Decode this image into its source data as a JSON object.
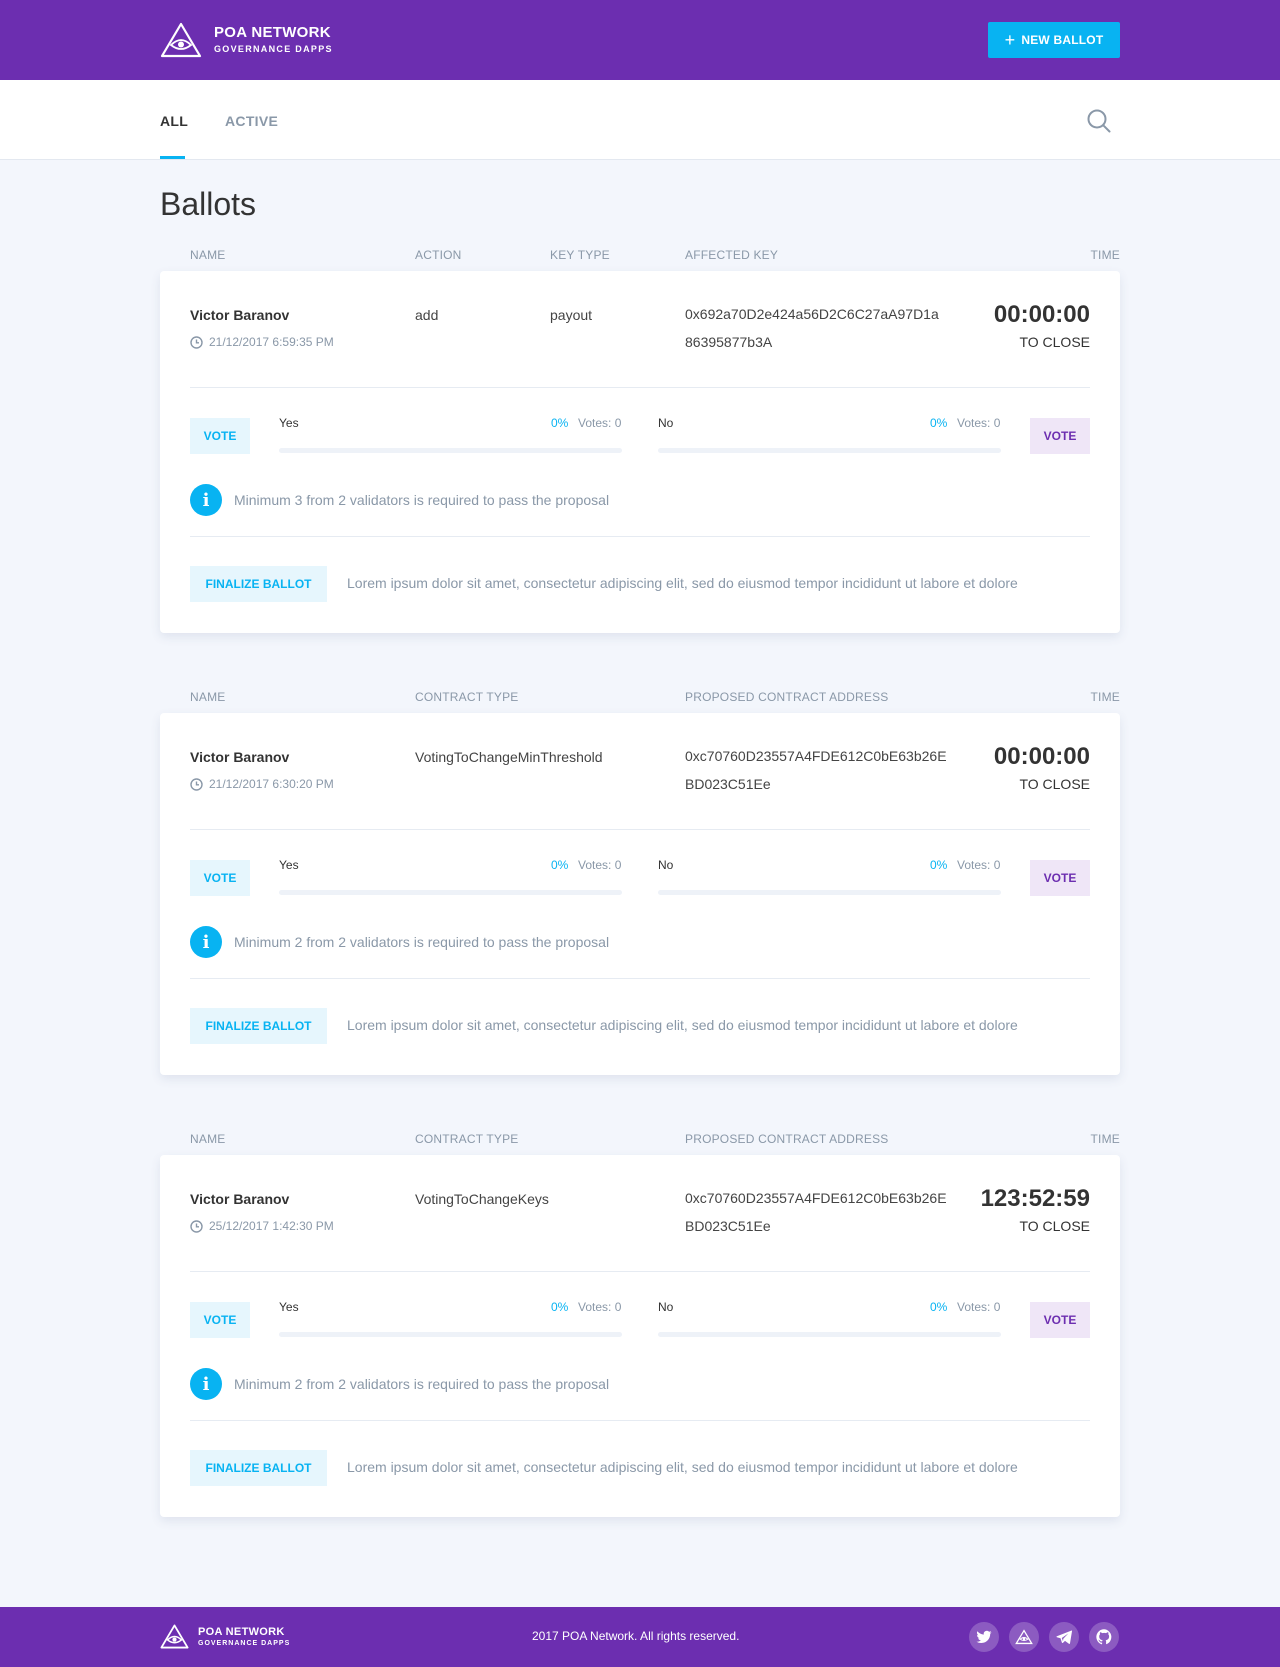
{
  "header": {
    "logo_title": "POA NETWORK",
    "logo_subtitle": "GOVERNANCE DAPPS",
    "new_ballot_label": "NEW BALLOT",
    "new_ballot_icon": "plus-icon"
  },
  "nav": {
    "tabs": [
      {
        "label": "ALL",
        "active": true
      },
      {
        "label": "ACTIVE",
        "active": false
      }
    ],
    "search_icon": "search-icon"
  },
  "page_title": "Ballots",
  "colors": {
    "brand_purple": "#6c2eb0",
    "accent_blue": "#08b3f2",
    "background": "#f3f6fc",
    "muted_text": "#8a98a8"
  },
  "ballots": [
    {
      "columns": {
        "name": "NAME",
        "col2": "ACTION",
        "col3": "KEY TYPE",
        "col4": "AFFECTED KEY",
        "time": "TIME"
      },
      "name": "Victor Baranov",
      "date": "21/12/2017 6:59:35 PM",
      "col2_value": "add",
      "col3_value": "payout",
      "address_line1": "0x692a70D2e424a56D2C6C27aA97D1a",
      "address_line2": "86395877b3A",
      "time": "00:00:00",
      "time_caption": "TO CLOSE",
      "vote_yes_label": "VOTE",
      "vote_no_label": "VOTE",
      "yes": {
        "label": "Yes",
        "percent": "0%",
        "votes": "Votes: 0",
        "fill": 0
      },
      "no": {
        "label": "No",
        "percent": "0%",
        "votes": "Votes: 0",
        "fill": 0
      },
      "info": "Minimum 3 from 2 validators is required to pass the proposal",
      "finalize_label": "FINALIZE BALLOT",
      "description": "Lorem ipsum dolor sit amet, consectetur adipiscing elit, sed do eiusmod tempor incididunt ut labore et dolore"
    },
    {
      "columns": {
        "name": "NAME",
        "col2": "CONTRACT TYPE",
        "col3": "",
        "col4": "PROPOSED CONTRACT ADDRESS",
        "time": "TIME"
      },
      "name": "Victor Baranov",
      "date": "21/12/2017 6:30:20 PM",
      "col2_value": "VotingToChangeMinThreshold",
      "col3_value": "",
      "address_line1": "0xc70760D23557A4FDE612C0bE63b26E",
      "address_line2": "BD023C51Ee",
      "time": "00:00:00",
      "time_caption": "TO CLOSE",
      "vote_yes_label": "VOTE",
      "vote_no_label": "VOTE",
      "yes": {
        "label": "Yes",
        "percent": "0%",
        "votes": "Votes: 0",
        "fill": 0
      },
      "no": {
        "label": "No",
        "percent": "0%",
        "votes": "Votes: 0",
        "fill": 0
      },
      "info": "Minimum 2 from 2 validators is required to pass the proposal",
      "finalize_label": "FINALIZE BALLOT",
      "description": "Lorem ipsum dolor sit amet, consectetur adipiscing elit, sed do eiusmod tempor incididunt ut labore et dolore"
    },
    {
      "columns": {
        "name": "NAME",
        "col2": "CONTRACT TYPE",
        "col3": "",
        "col4": "PROPOSED CONTRACT ADDRESS",
        "time": "TIME"
      },
      "name": "Victor Baranov",
      "date": "25/12/2017 1:42:30 PM",
      "col2_value": "VotingToChangeKeys",
      "col3_value": "",
      "address_line1": "0xc70760D23557A4FDE612C0bE63b26E",
      "address_line2": "BD023C51Ee",
      "time": "123:52:59",
      "time_caption": "TO CLOSE",
      "vote_yes_label": "VOTE",
      "vote_no_label": "VOTE",
      "yes": {
        "label": "Yes",
        "percent": "0%",
        "votes": "Votes: 0",
        "fill": 0
      },
      "no": {
        "label": "No",
        "percent": "0%",
        "votes": "Votes: 0",
        "fill": 0
      },
      "info": "Minimum 2 from 2 validators is required to pass the proposal",
      "finalize_label": "FINALIZE BALLOT",
      "description": "Lorem ipsum dolor sit amet, consectetur adipiscing elit, sed do eiusmod tempor incididunt ut labore et dolore"
    }
  ],
  "footer": {
    "logo_title": "POA NETWORK",
    "logo_subtitle": "GOVERNANCE DAPPS",
    "copyright": "2017 POA Network. All rights reserved.",
    "social_icons": [
      "twitter-icon",
      "poa-icon",
      "telegram-icon",
      "github-icon"
    ]
  }
}
